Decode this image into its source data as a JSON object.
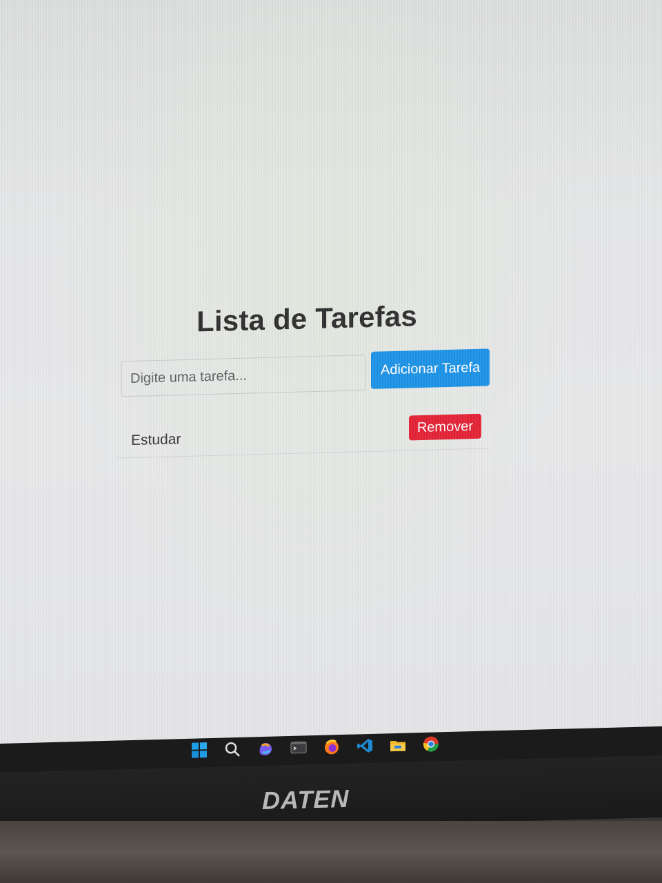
{
  "app": {
    "title": "Lista de Tarefas",
    "input_placeholder": "Digite uma tarefa...",
    "add_button_label": "Adicionar Tarefa",
    "tasks": [
      {
        "text": "Estudar",
        "remove_label": "Remover"
      }
    ]
  },
  "colors": {
    "add_button": "#1c92e6",
    "remove_button": "#e32235",
    "title_text": "#2e2e2e"
  },
  "taskbar": {
    "icons": [
      "windows-start-icon",
      "search-icon",
      "copilot-icon",
      "terminal-icon",
      "firefox-icon",
      "vscode-icon",
      "file-explorer-icon",
      "chrome-icon"
    ]
  },
  "monitor": {
    "brand": "DATEN"
  }
}
